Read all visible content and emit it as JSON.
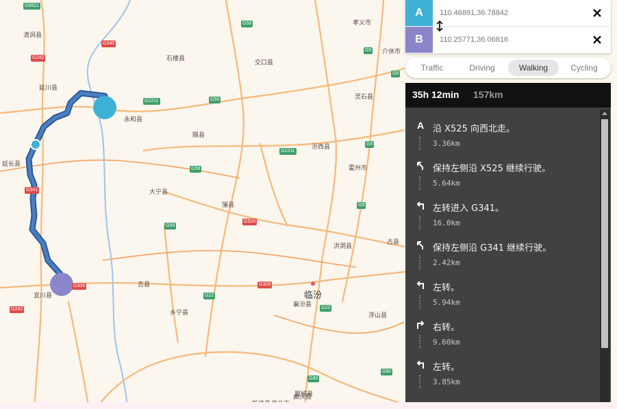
{
  "waypoints": [
    {
      "label": "A",
      "value": "110.46891,36.78842",
      "color": "#40b1d6"
    },
    {
      "label": "B",
      "value": "110.25771,36.06816",
      "color": "#8b86c9"
    }
  ],
  "modes": [
    {
      "label": "Traffic",
      "active": false
    },
    {
      "label": "Driving",
      "active": false
    },
    {
      "label": "Walking",
      "active": true
    },
    {
      "label": "Cycling",
      "active": false
    }
  ],
  "summary": {
    "time": "35h 12min",
    "distance": "157km"
  },
  "steps": [
    {
      "icon": "start-a-icon",
      "text": "沿 X525 向西北走。",
      "dist": "3.36km"
    },
    {
      "icon": "keep-left-icon",
      "text": "保持左侧沿 X525 继续行驶。",
      "dist": "5.64km"
    },
    {
      "icon": "turn-left-icon",
      "text": "左转进入 G341。",
      "dist": "16.0km"
    },
    {
      "icon": "keep-left-icon",
      "text": "保持左侧沿 G341 继续行驶。",
      "dist": "2.42km"
    },
    {
      "icon": "turn-left-icon",
      "text": "左转。",
      "dist": "5.94km"
    },
    {
      "icon": "turn-right-icon",
      "text": "右转。",
      "dist": "9.60km"
    },
    {
      "icon": "turn-left-icon",
      "text": "左转。",
      "dist": "3.85km"
    }
  ],
  "map": {
    "route_color": "#3a6fb5",
    "places": [
      "清涧县",
      "延川县",
      "石楼县",
      "交口县",
      "孝义市",
      "介休市",
      "灵石县",
      "永和县",
      "隰县",
      "汾西县",
      "霍州市",
      "延长县",
      "大宁县",
      "蒲县",
      "洪洞县",
      "古县",
      "吉县",
      "乡宁县",
      "襄汾县",
      "浮山县",
      "宜川县",
      "翼城县",
      "曲沃县",
      "侯马市",
      "新绛县"
    ],
    "city": "临汾",
    "shields_green": [
      "G6521",
      "G59",
      "G55",
      "G2211",
      "G2211",
      "G59",
      "G5",
      "G5",
      "G5",
      "G59",
      "G22",
      "G22",
      "G80",
      "G80",
      "G5"
    ],
    "shields_red": [
      "G340",
      "G242",
      "G520",
      "G309",
      "G309",
      "G242",
      "G341"
    ]
  }
}
